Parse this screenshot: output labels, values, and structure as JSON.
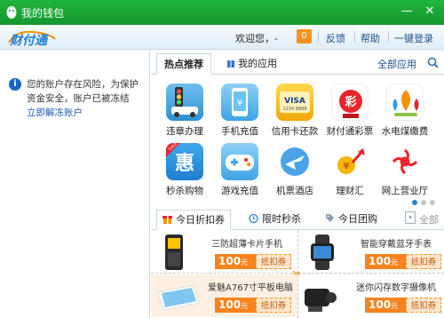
{
  "window": {
    "title": "我的钱包",
    "minimize_glyph": "—",
    "close_glyph": "✕"
  },
  "header": {
    "logo_text": "财付通",
    "welcome": "欢迎您，-",
    "count": "0",
    "links": [
      "反馈",
      "帮助",
      "一键登录"
    ]
  },
  "risk_notice": {
    "icon": "info-icon",
    "message": "您的账户存在风险，为保护资金安全，账户已被冻结",
    "action": "立即解冻账户"
  },
  "app_tabs": {
    "items": [
      "热点推荐",
      "我的应用"
    ],
    "active": "热点推荐",
    "all_label": "全部应用"
  },
  "apps": [
    {
      "label": "违章办理",
      "icon": "traffic-light-icon"
    },
    {
      "label": "手机充值",
      "icon": "phone-topup-icon"
    },
    {
      "label": "信用卡还款",
      "icon": "visa-card-icon"
    },
    {
      "label": "财付通彩票",
      "icon": "lottery-icon"
    },
    {
      "label": "水电煤缴费",
      "icon": "utilities-icon"
    },
    {
      "label": "秒杀购物",
      "icon": "flash-sale-icon",
      "badge": "惠",
      "sale": "SALE"
    },
    {
      "label": "游戏充值",
      "icon": "gamepad-icon"
    },
    {
      "label": "机票酒店",
      "icon": "plane-icon"
    },
    {
      "label": "理财汇",
      "icon": "wealth-icon"
    },
    {
      "label": "网上营业厅",
      "icon": "china-unicom-icon"
    }
  ],
  "deal_tabs": {
    "items": [
      "今日折扣券",
      "限时秒杀",
      "今日团购"
    ],
    "active": "今日折扣券",
    "more_arrow": "›",
    "all_label": "全部"
  },
  "deals": [
    {
      "title": "三防超薄卡片手机",
      "price": "100",
      "unit": "元",
      "coupon": "抵扣券",
      "icon": "card-phone-icon"
    },
    {
      "title": "智能穿戴蓝牙手表",
      "price": "100",
      "unit": "元",
      "coupon": "抵扣券",
      "icon": "smartwatch-icon"
    },
    {
      "title": "爱魅A767寸平板电脑",
      "price": "100",
      "unit": "元",
      "coupon": "抵扣券",
      "icon": "tablet-icon"
    },
    {
      "title": "迷你闪存数字摄像机",
      "price": "100",
      "unit": "元",
      "coupon": "抵扣券",
      "icon": "camcorder-icon"
    }
  ],
  "colors": {
    "titlebar": "#1aa83a",
    "accent_orange": "#f7831e",
    "link_blue": "#1a4f8c"
  }
}
